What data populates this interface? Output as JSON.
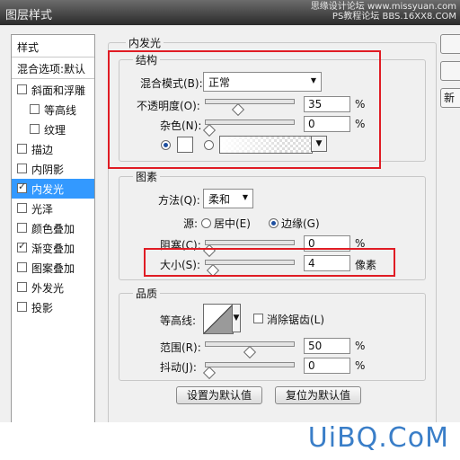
{
  "window": {
    "title": "图层样式",
    "watermark_top": "思缘设计论坛 www.missyuan.com",
    "watermark_top2": "PS教程论坛 BBS.16XX8.COM"
  },
  "left_panel": {
    "header": "样式",
    "blend_options": "混合选项:默认",
    "items": [
      {
        "label": "斜面和浮雕",
        "checked": false
      },
      {
        "label": "等高线",
        "checked": false
      },
      {
        "label": "纹理",
        "checked": false
      },
      {
        "label": "描边",
        "checked": false
      },
      {
        "label": "内阴影",
        "checked": false
      },
      {
        "label": "内发光",
        "checked": true,
        "selected": true
      },
      {
        "label": "光泽",
        "checked": false
      },
      {
        "label": "颜色叠加",
        "checked": false
      },
      {
        "label": "渐变叠加",
        "checked": true
      },
      {
        "label": "图案叠加",
        "checked": false
      },
      {
        "label": "外发光",
        "checked": false
      },
      {
        "label": "投影",
        "checked": false
      }
    ]
  },
  "main": {
    "section_title": "内发光",
    "structure": {
      "title": "结构",
      "blend_mode_label": "混合模式(B):",
      "blend_mode_value": "正常",
      "opacity_label": "不透明度(O):",
      "opacity_value": "35",
      "opacity_pct": 35,
      "noise_label": "杂色(N):",
      "noise_value": "0",
      "noise_pct": 0,
      "percent": "%"
    },
    "elements": {
      "title": "图素",
      "method_label": "方法(Q):",
      "method_value": "柔和",
      "source_label": "源:",
      "source_center": "居中(E)",
      "source_edge": "边缘(G)",
      "choke_label": "阻塞(C):",
      "choke_value": "0",
      "choke_pct": 0,
      "size_label": "大小(S):",
      "size_value": "4",
      "size_unit": "像素",
      "percent": "%"
    },
    "quality": {
      "title": "品质",
      "contour_label": "等高线:",
      "antialias_label": "消除锯齿(L)",
      "range_label": "范围(R):",
      "range_value": "50",
      "range_pct": 50,
      "jitter_label": "抖动(J):",
      "jitter_value": "0",
      "jitter_pct": 0,
      "percent": "%"
    },
    "buttons": {
      "make_default": "设置为默认值",
      "reset_default": "复位为默认值"
    }
  },
  "right_buttons": {
    "third_label": "新"
  },
  "watermark_bottom": "UiBQ.CoM",
  "colors": {
    "highlight": "#e01c24",
    "selection": "#3399ff",
    "watermark_blue": "#3a7ec8"
  }
}
